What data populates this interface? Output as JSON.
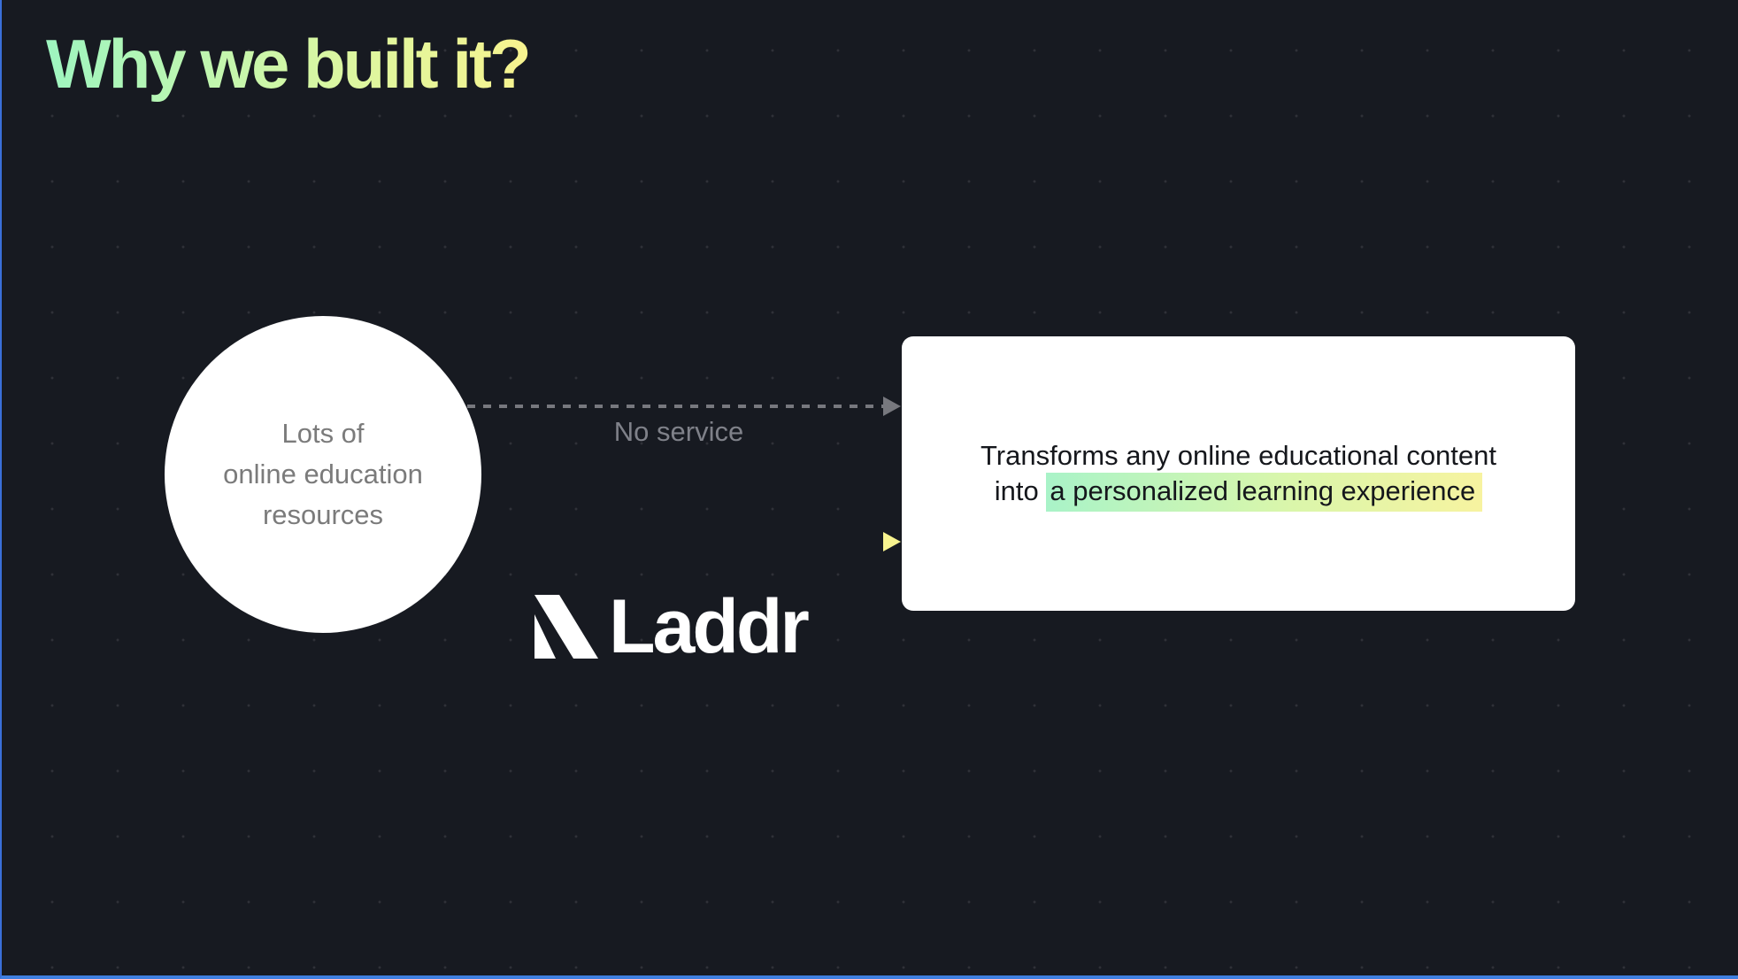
{
  "slide": {
    "title": "Why we built it?",
    "source": {
      "line1": "Lots of",
      "line2": "online education",
      "line3": "resources"
    },
    "connector_no_service": {
      "label": "No service",
      "style": "dashed",
      "color": "#77787e"
    },
    "connector_laddr": {
      "style": "solid",
      "gradient": [
        "#9ef5c0",
        "#f7f38f"
      ]
    },
    "logo": {
      "icon": "laddr-logo-mark",
      "wordmark": "Laddr"
    },
    "result_card": {
      "line1": "Transforms any online educational content",
      "line2_prefix": "into",
      "highlight": "a personalized learning experience"
    }
  }
}
